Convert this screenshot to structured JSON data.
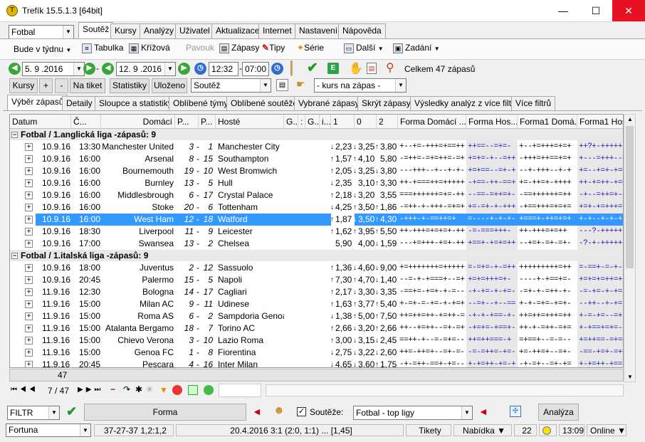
{
  "window": {
    "title": "Trefík 15.5.1.3 [64bit]",
    "min": "—",
    "max": "☐",
    "close": "✕"
  },
  "sport_select": "Fotbal",
  "period_select": "Bude v týdnu",
  "tabs": [
    "Soutěž",
    "Kursy",
    "Analýzy",
    "Uživatel",
    "Aktualizace",
    "Internet",
    "Nastavení",
    "Nápověda"
  ],
  "toolbar": {
    "tabulka": "Tabulka",
    "krizova": "Křížová",
    "pavouk": "Pavouk",
    "zapasy": "Zápasy",
    "tipy": "Tipy",
    "serie": "Série",
    "dalsi": "Další",
    "zadani": "Zadání"
  },
  "filterbar": {
    "date_from": "5. 9 .2016",
    "date_to": "12. 9 .2016",
    "time_from": "12:32",
    "time_to": "07:00",
    "dash": "-",
    "total": "Celkem 47 zápasů"
  },
  "buttons": {
    "kursy": "Kursy",
    "plus": "+",
    "minus": "-",
    "na_tiket": "Na tiket",
    "statistiky": "Statistiky",
    "ulozeno": "Uloženo",
    "soutez": "Soutěž",
    "kurs_na_zapas": "- kurs na zápas -"
  },
  "subtabs": [
    "Výběr zápasů",
    "Detaily",
    "Sloupce a statistiky",
    "Oblíbené týmy",
    "Oblíbené soutěže",
    "Vybrané zápasy",
    "Skrýt zápasy",
    "Výsledky analýz z více filtrů",
    "Více filtrů"
  ],
  "columns": [
    "Datum",
    "Č...",
    "Domácí",
    "P...",
    "P...",
    "Hosté",
    "G...",
    ":",
    "G...",
    "i...",
    "1",
    "0",
    "2",
    "Forma Domácí ...",
    "Forma Hos...",
    "Forma1 Domá...",
    "Forma1 Hosté"
  ],
  "groups": [
    {
      "title": "Fotbal / 1.anglická liga -zápasů: 9",
      "rows": [
        [
          "10.9.16",
          "13:30",
          "Manchester United",
          "3",
          "1",
          "Manchester City",
          "↓",
          "2,23",
          "↓",
          "3,25",
          "↑",
          "3,80",
          "+--+=-+++=+==++",
          "++==--=+=-",
          "+--+=+++=+=+",
          "++?+-+++++"
        ],
        [
          "10.9.16",
          "16:00",
          "Arsenal",
          "8",
          "15",
          "Southampton",
          "↑",
          "1,57",
          "↑",
          "4,10",
          "",
          "5,80",
          "-=++=-=+=++=-=+",
          "+=+=-+--=++",
          "-+++=++==+=+",
          "+---=+++--+"
        ],
        [
          "10.9.16",
          "16:00",
          "Bournemouth",
          "19",
          "10",
          "West Bromwich",
          "↑",
          "2,05",
          "↓",
          "3,25",
          "↓",
          "3,80",
          "---+++--+--+-+-",
          "+=+==--=+-+",
          "--+-+++--+-+",
          "+=--+=+-+=+"
        ],
        [
          "10.9.16",
          "16:00",
          "Burnley",
          "13",
          "5",
          "Hull",
          "↓",
          "2,35",
          "",
          "3,10",
          "↑",
          "3,30",
          "++-+===++=+++++",
          "-+==-++-==+",
          "+=-++=+-++++",
          "++-+=++-+=+"
        ],
        [
          "10.9.16",
          "16:00",
          "Middlesbrough",
          "6",
          "17",
          "Crystal Palace",
          "↑",
          "2,18",
          "↓",
          "3,20",
          "",
          "3,55",
          "===++++++=+=-++",
          "--==-=++=+-",
          "-==++++++=++",
          "-+--=++=+-+"
        ],
        [
          "10.9.16",
          "16:00",
          "Stoke",
          "20",
          "6",
          "Tottenham",
          "↓",
          "4,25",
          "↑",
          "3,50",
          "↑",
          "1,86",
          "-=++-+-+++-=+=+",
          "+=-=+-+-+++",
          "-+==+++=+=+=",
          "+=+-+=+++=+"
        ],
        [
          "10.9.16",
          "16:00",
          "West Ham",
          "12",
          "18",
          "Watford",
          "↑",
          "1,87",
          "↓",
          "3,50",
          "↑",
          "4,30",
          "-+++-+-==++=+",
          "=----+-+-+--",
          "+===+-++=+=+",
          "+-+--+-+-+"
        ],
        [
          "10.9.16",
          "18:30",
          "Liverpool",
          "11",
          "9",
          "Leicester",
          "↑",
          "1,62",
          "↑",
          "3,95",
          "↑",
          "5,50",
          "++-+++=+=+=+-++",
          "-=-===+++-",
          "++-+++=+=++",
          "---?-+++++"
        ],
        [
          "10.9.16",
          "17:00",
          "Swansea",
          "13",
          "2",
          "Chelsea",
          "",
          "5,90",
          "",
          "4,00",
          "↓",
          "1,59",
          "---+=+++-+=+-++",
          "+==+-+=+=++",
          "--+=+-=+-=+-",
          "-?-+-+++++"
        ]
      ]
    },
    {
      "title": "Fotbal / 1.italská liga -zápasů: 9",
      "rows": [
        [
          "10.9.16",
          "18:00",
          "Juventus",
          "2",
          "12",
          "Sassuolo",
          "↑",
          "1,36",
          "↓",
          "4,60",
          "↓",
          "9,00",
          "+=+++++++=+++++",
          "=-=+=-+-=++",
          "+++++++++=++",
          "=-==+-=-+-+"
        ],
        [
          "10.9.16",
          "20:45",
          "Palermo",
          "15",
          "5",
          "Napoli",
          "↑",
          "7,30",
          "↑",
          "4,70",
          "↓",
          "1,40",
          "--=-+-+===+--=+",
          "+=+=+++=+-",
          "----+-+==+=-",
          "+=+=+=++=++"
        ],
        [
          "11.9.16",
          "12:30",
          "Bologna",
          "14",
          "17",
          "Cagliari",
          "↑",
          "2,17",
          "↓",
          "3,30",
          "↓",
          "3,35",
          "-==+=-+=+-+-=--",
          "-+-+=-+-+=-",
          "-=+-+-=++-+-",
          "-=-+=-+-+=-"
        ],
        [
          "11.9.16",
          "15:00",
          "Milan AC",
          "9",
          "11",
          "Udinese",
          "↑",
          "1,63",
          "↑",
          "3,77",
          "↑",
          "5,40",
          "+-=+-=-+=-+-+=+",
          "--=+--+--==",
          "+-+-=+=-+=+-",
          "--++--+-+=-"
        ],
        [
          "11.9.16",
          "15:00",
          "Roma AS",
          "6",
          "2",
          "Sampdoria Genoa",
          "↓",
          "1,38",
          "↑",
          "5,00",
          "↑",
          "7,50",
          "++=++=++-+=++-=",
          "-+-+-+==-+-",
          "++=++=+++=++",
          "+-=-+=--=+-"
        ],
        [
          "11.9.16",
          "15:00",
          "Atalanta Bergamo",
          "18",
          "7",
          "Torino AC",
          "↑",
          "2,66",
          "↓",
          "3,20",
          "↑",
          "2,66",
          "++--+=++--=+-=+",
          "-+=+=-+==+-",
          "++-+-=++-=+=",
          "+-+==+=+=-+"
        ],
        [
          "11.9.16",
          "15:00",
          "Chievo Verona",
          "3",
          "10",
          "Lazio Roma",
          "↑",
          "3,00",
          "↓",
          "3,15",
          "↓",
          "2,45",
          "==++-+--=-=+=--",
          "++=++===-+",
          "=+==+--=-=--",
          "+=++==-=+=="
        ],
        [
          "11.9.16",
          "15:00",
          "Genoa FC",
          "1",
          "8",
          "Fiorentina",
          "↓",
          "2,75",
          "↓",
          "3,22",
          "↓",
          "2,60",
          "++=-++=+--=+-=-",
          "-=-=++=-+=-",
          "+=-++=+--=+-",
          "-==-+=+-=+="
        ],
        [
          "11.9.16",
          "20:45",
          "Pescara",
          "4",
          "16",
          "Inter Milan",
          "↓",
          "4,65",
          "↓",
          "3,60",
          "↑",
          "1,75",
          "-+-=++-==+-+=--",
          "+-+=++-+=-+",
          "-+-=+--=+-+=",
          "+-+=++-+==-"
        ]
      ]
    }
  ],
  "footer": {
    "count": "47",
    "pager": "7 / 47",
    "filtr": "FILTR",
    "forma": "Forma",
    "souteze_label": "Soutěže:",
    "souteze_value": "Fotbal - top ligy",
    "analyza": "Analýza"
  },
  "status": {
    "bookmaker": "Fortuna",
    "rec": "37-27-37  1,2:1,2",
    "last": "20.4.2016 3:1 (2:0, 1:1) ... [1,45]",
    "tikety": "Tikety",
    "nabidka": "Nabídka ▼",
    "num": "22",
    "time": "13:09",
    "online": "Online ▼"
  },
  "colors": {
    "selection": "#3399ff",
    "close": "#e81123",
    "form_blue": "#1717b8"
  }
}
